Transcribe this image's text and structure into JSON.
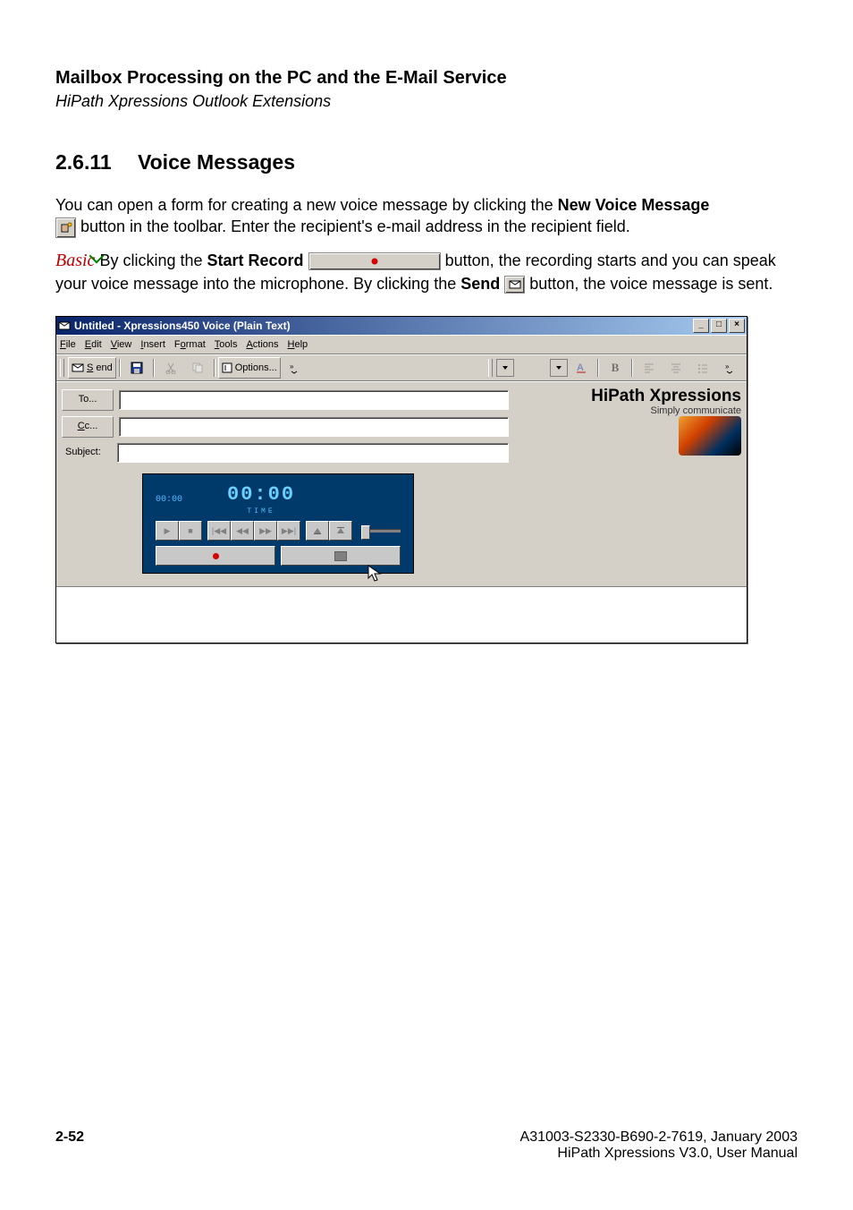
{
  "header": {
    "title": "Mailbox Processing on the PC and the E-Mail Service",
    "subtitle": "HiPath Xpressions Outlook Extensions"
  },
  "section": {
    "number": "2.6.11",
    "title": "Voice Messages"
  },
  "para1": {
    "t1": "You can open a form for creating a new voice message by clicking the ",
    "b1": "New Voice Message",
    "t2": " button in the toolbar. Enter the recipient's e-mail address in the recipient field."
  },
  "para2": {
    "tag": "Basic",
    "t1": "  By clicking the ",
    "b1": "Start Record",
    "t2": " button, the recording starts and you can speak your voice message into the microphone. By clicking the ",
    "b2": "Send",
    "t3": " button, the voice message is sent."
  },
  "window": {
    "title": "Untitled - Xpressions450 Voice (Plain Text)",
    "menu": [
      "File",
      "Edit",
      "View",
      "Insert",
      "Format",
      "Tools",
      "Actions",
      "Help"
    ],
    "menu_underline_idx": [
      0,
      0,
      0,
      0,
      1,
      0,
      0,
      0
    ],
    "toolbar": {
      "send": "Send",
      "options": "Options..."
    },
    "fields": {
      "to": "To...",
      "cc": "Cc...",
      "subject": "Subject:"
    },
    "brand": {
      "title": "HiPath Xpressions",
      "sub": "Simply communicate"
    },
    "player": {
      "small": "00:00",
      "big": "00:00",
      "label": "TIME"
    }
  },
  "footer": {
    "page": "2-52",
    "docid": "A31003-S2330-B690-2-7619, January 2003",
    "docname": "HiPath Xpressions V3.0, User Manual"
  }
}
